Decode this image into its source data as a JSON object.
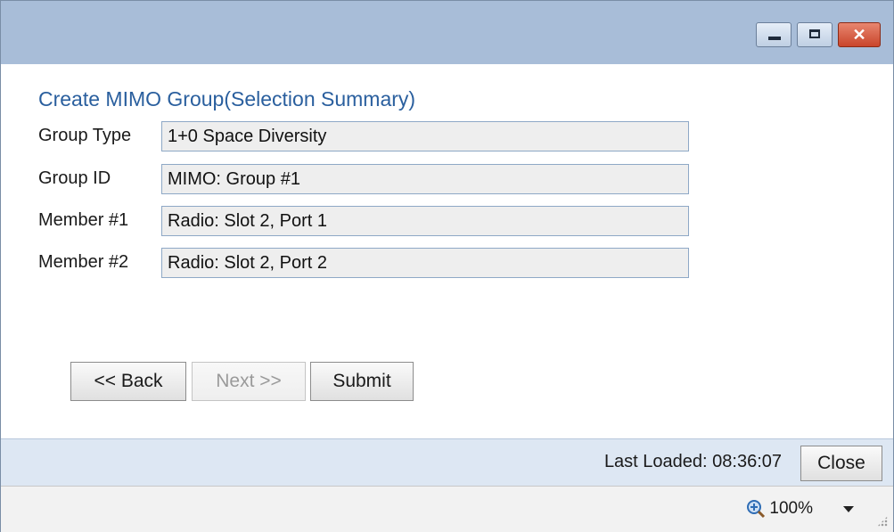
{
  "dialog": {
    "title": "Create MIMO Group(Selection Summary)",
    "fields": [
      {
        "label": "Group Type",
        "value": "1+0 Space Diversity"
      },
      {
        "label": "Group ID",
        "value": "MIMO: Group #1"
      },
      {
        "label": "Member #1",
        "value": "Radio: Slot 2, Port 1"
      },
      {
        "label": "Member #2",
        "value": "Radio: Slot 2, Port 2"
      }
    ],
    "buttons": {
      "back": "<< Back",
      "next": "Next >>",
      "submit": "Submit"
    }
  },
  "footer": {
    "last_loaded": "Last Loaded: 08:36:07",
    "close": "Close"
  },
  "statusbar": {
    "zoom": "100%",
    "zoom_icon": "zoom-in-icon"
  },
  "window_controls": {
    "close_glyph": "✕"
  },
  "colors": {
    "titlebar": "#a8bdd8",
    "title_text": "#2a5f9e",
    "close_button": "#c9452b",
    "footer_bg": "#dde7f3"
  }
}
